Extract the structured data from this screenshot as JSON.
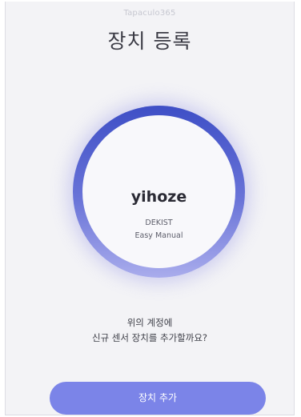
{
  "header": {
    "app_name": "Tapaculo365",
    "title": "장치 등록"
  },
  "device": {
    "name": "yihoze",
    "brand": "DEKIST",
    "mode": "Easy Manual"
  },
  "prompt": {
    "line1": "위의 계정에",
    "line2": "신규 센서 장치를 추가할까요?"
  },
  "actions": {
    "add_label": "장치 추가"
  },
  "colors": {
    "accent": "#7b84e8",
    "ring_top": "#3e4fc6",
    "ring_bottom": "#a9acec",
    "background": "#f3f3f6"
  }
}
